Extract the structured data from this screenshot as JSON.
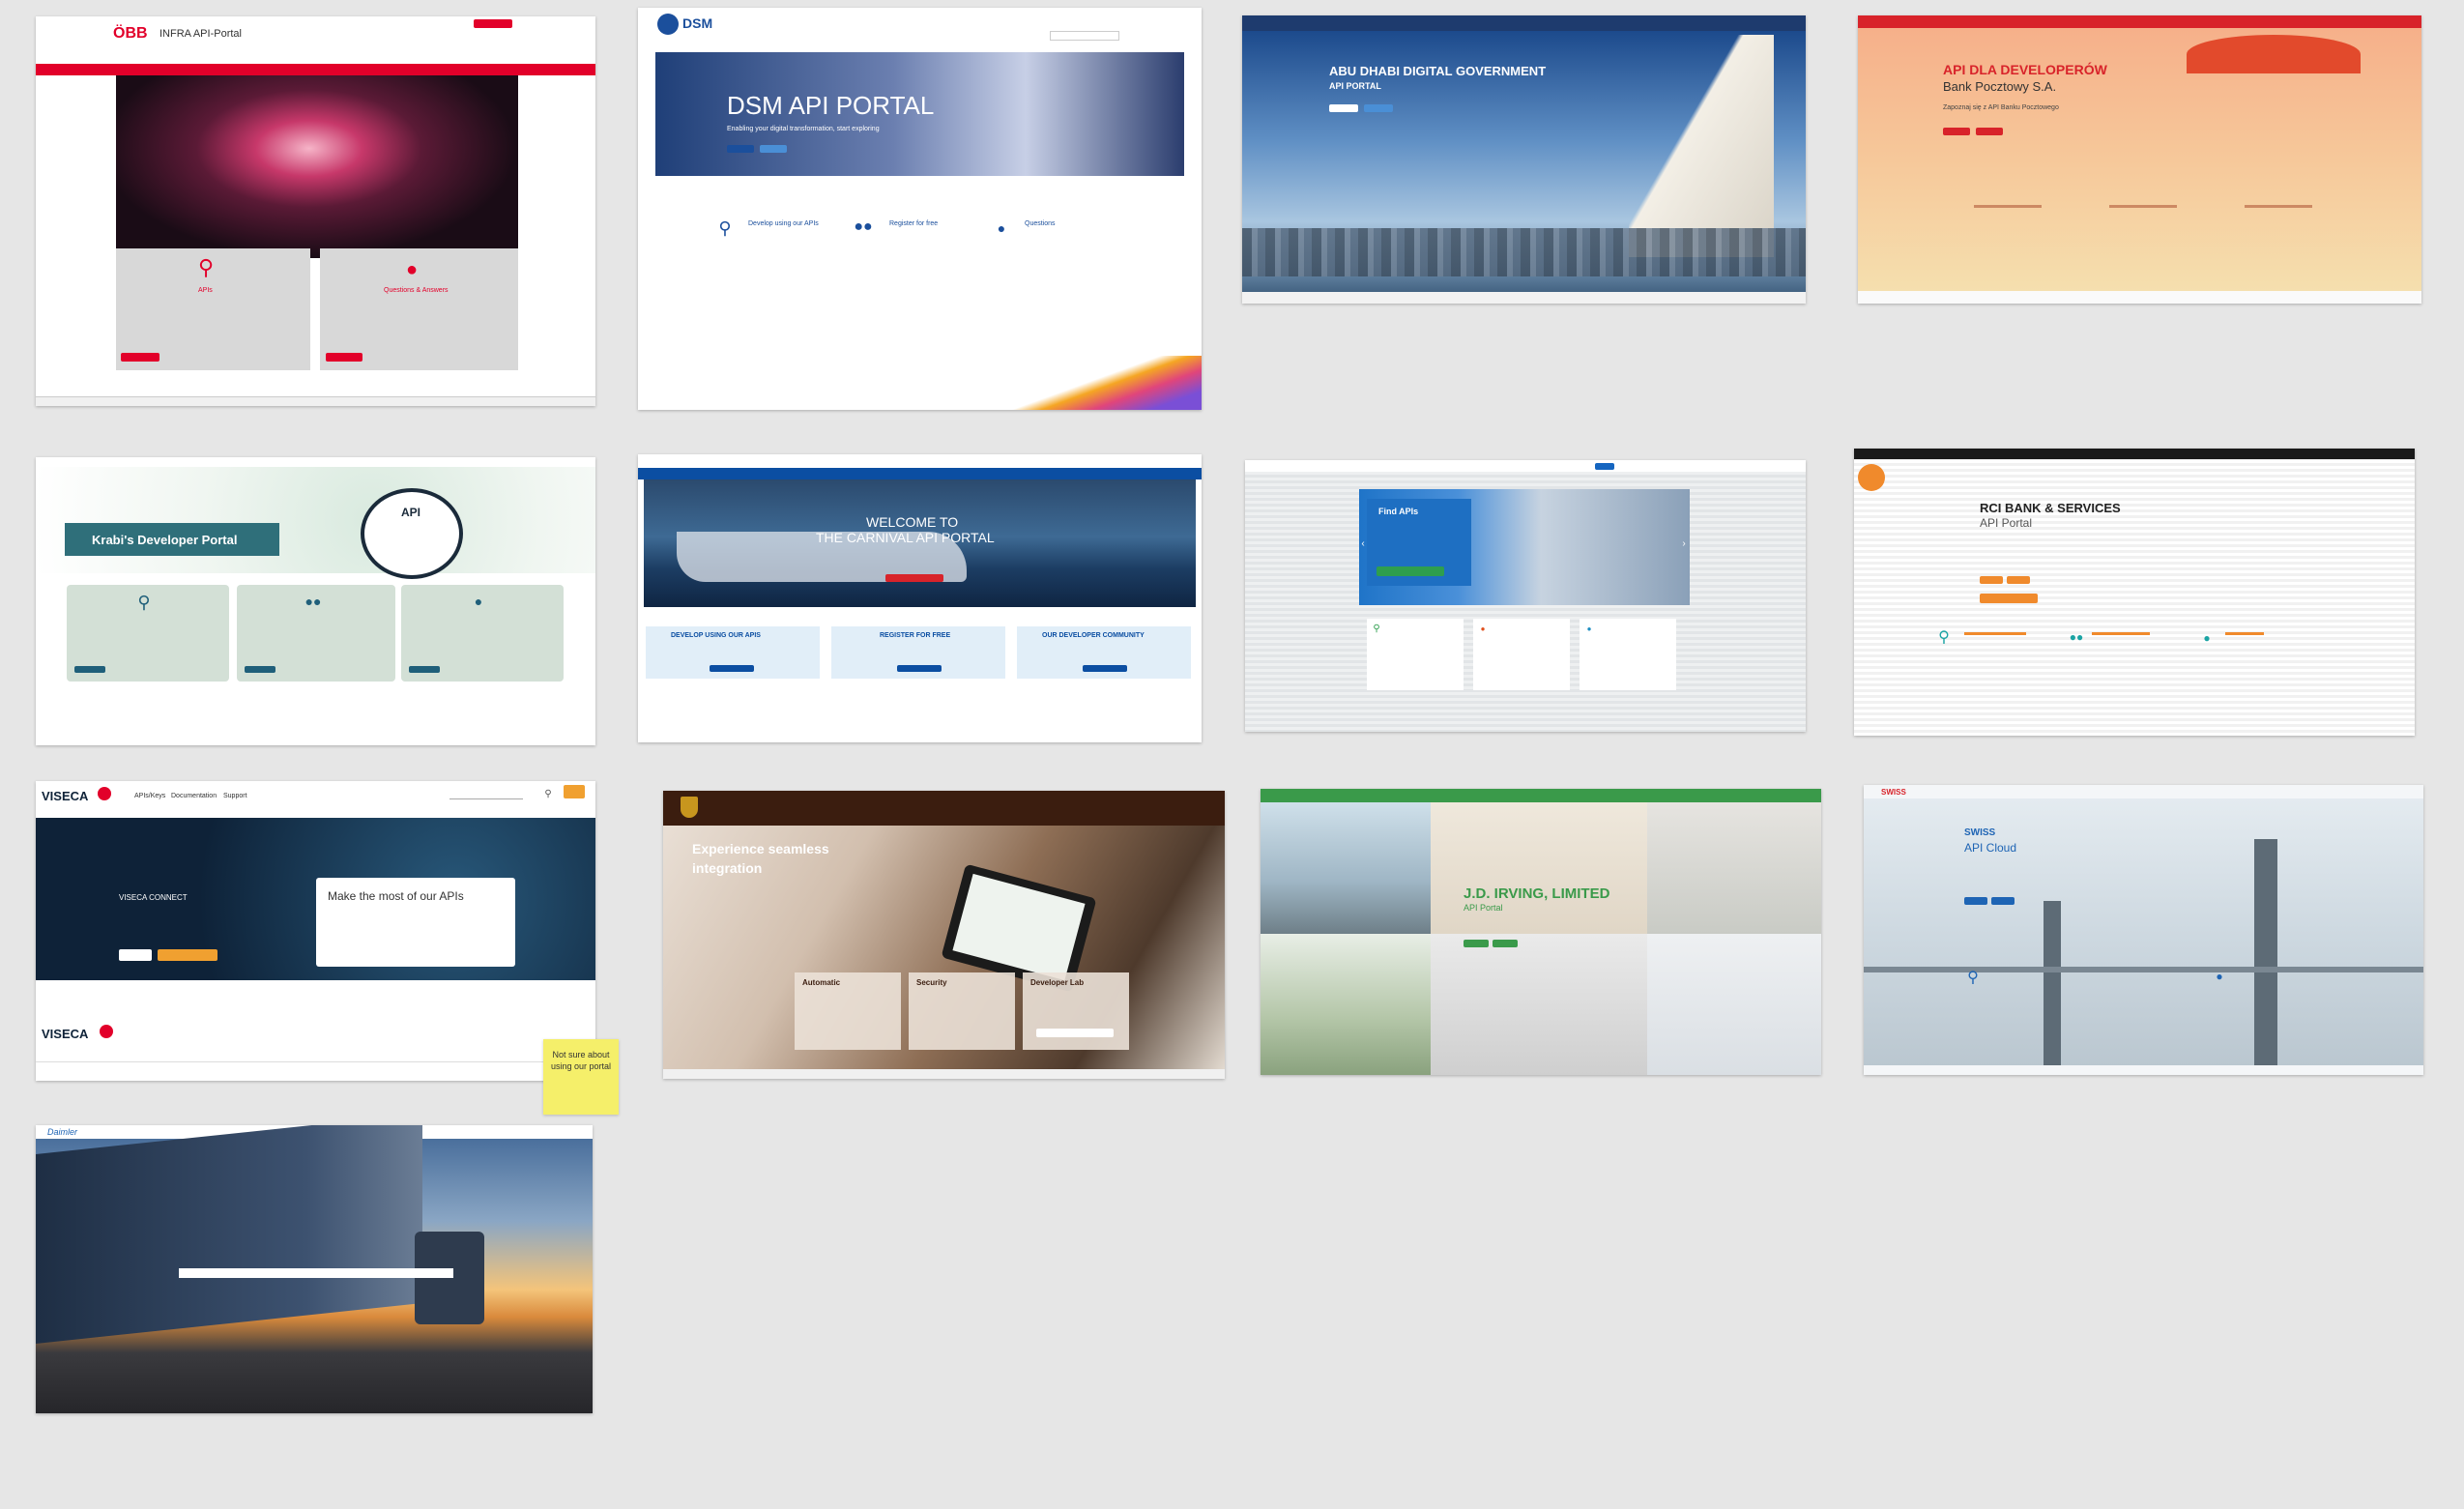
{
  "thumbs": {
    "oebb": {
      "logo": "ÖBB",
      "title": "INFRA API-Portal",
      "card1_title": "APIs",
      "card2_title": "Questions & Answers"
    },
    "dsm": {
      "logo": "DSM",
      "hero_title": "DSM API PORTAL",
      "hero_sub": "Enabling your digital transformation, start exploring",
      "f1": "Develop using our APIs",
      "f2": "Register for free",
      "f3": "Questions"
    },
    "abudhabi": {
      "title": "ABU DHABI DIGITAL GOVERNMENT",
      "subtitle": "API PORTAL"
    },
    "pocztowy": {
      "title": "API DLA DEVELOPERÓW",
      "subtitle": "Bank Pocztowy S.A.",
      "tagline": "Zapoznaj się z API Banku Pocztowego"
    },
    "krabi": {
      "title": "Krabi's Developer Portal",
      "badge": "API"
    },
    "carnival": {
      "hero_line1": "WELCOME TO",
      "hero_line2": "THE CARNIVAL API PORTAL",
      "c1": "DEVELOP USING OUR APIS",
      "c2": "REGISTER FOR FREE",
      "c3": "OUR DEVELOPER COMMUNITY"
    },
    "findapis": {
      "title": "Find APIs"
    },
    "rci": {
      "title": "RCI BANK & SERVICES",
      "subtitle": "API Portal"
    },
    "viseca": {
      "logo": "VISECA",
      "nav": [
        "APIs/Keys",
        "Documentation",
        "Support"
      ],
      "hero_label": "VISECA CONNECT",
      "card_title": "Make the most of our APIs",
      "footer_logo": "VISECA",
      "sticky_note": "Not sure about using our portal"
    },
    "ups": {
      "hero_line1": "Experience seamless",
      "hero_line2": "integration",
      "card1": "Automatic",
      "card2": "Security",
      "card3": "Developer Lab"
    },
    "jdirving": {
      "title": "J.D. IRVING, LIMITED",
      "subtitle": "API Portal"
    },
    "bridge": {
      "logo": "SWISS",
      "title": "SWISS",
      "subtitle": "API Cloud"
    },
    "truck": {
      "logo": "Daimler"
    }
  },
  "colors": {
    "oebb_red": "#e2002a",
    "dsm_blue": "#1b4f9c",
    "carnival_blue": "#0b4ea2",
    "rci_orange": "#f08a2c",
    "viseca_navy": "#0e2238",
    "viseca_orange": "#f0a030",
    "ups_brown": "#3b1d0f",
    "jdi_green": "#3a9a4a",
    "sticky_yellow": "#f5ef6a"
  }
}
